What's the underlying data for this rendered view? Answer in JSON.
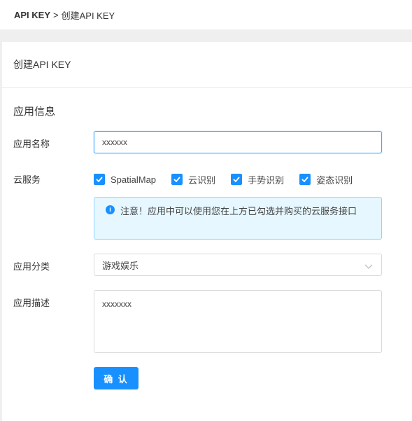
{
  "breadcrumb": {
    "root": "API KEY",
    "separator": ">",
    "current": "创建API KEY"
  },
  "card": {
    "title": "创建API KEY"
  },
  "form": {
    "section_title": "应用信息",
    "app_name": {
      "label": "应用名称",
      "value": "xxxxxx"
    },
    "cloud_services": {
      "label": "云服务",
      "options": [
        {
          "label": "SpatialMap",
          "checked": true
        },
        {
          "label": "云识别",
          "checked": true
        },
        {
          "label": "手势识别",
          "checked": true
        },
        {
          "label": "姿态识别",
          "checked": true
        }
      ],
      "notice": "注意！应用中可以使用您在上方已勾选并购买的云服务接口",
      "notice_icon": "info-icon"
    },
    "category": {
      "label": "应用分类",
      "value": "游戏娱乐"
    },
    "description": {
      "label": "应用描述",
      "value": "xxxxxxx"
    },
    "confirm_label": "确 认"
  },
  "colors": {
    "primary": "#1890ff",
    "alert_bg": "#e6f7ff",
    "alert_border": "#91d5ff"
  }
}
